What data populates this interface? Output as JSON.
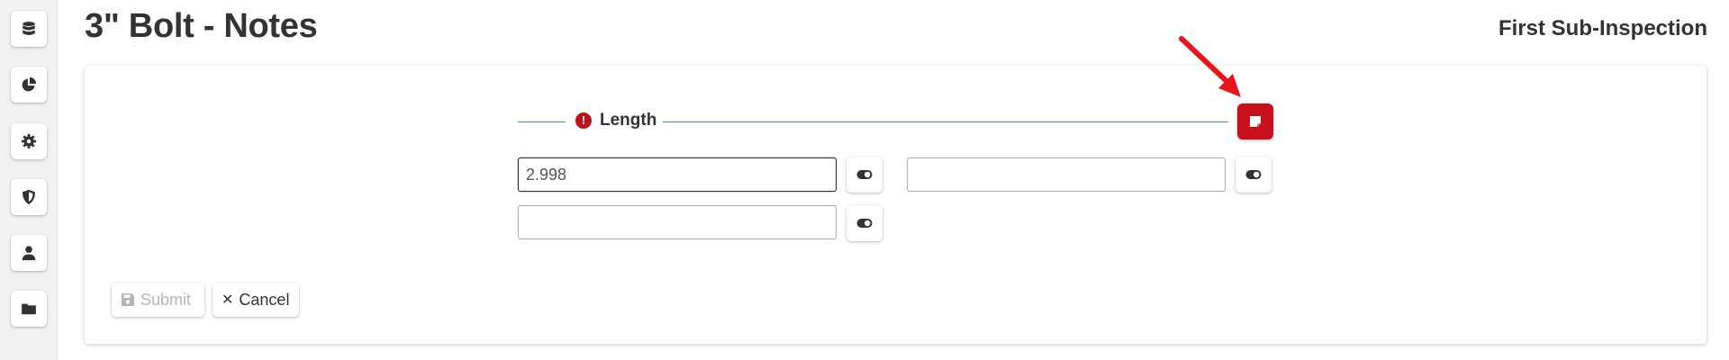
{
  "header": {
    "title": "3\" Bolt - Notes",
    "subtitle": "First Sub-Inspection"
  },
  "sidebar": {
    "items": [
      {
        "icon": "database-icon"
      },
      {
        "icon": "pie-chart-icon"
      },
      {
        "icon": "gear-icon"
      },
      {
        "icon": "shield-icon"
      },
      {
        "icon": "user-icon"
      },
      {
        "icon": "folder-icon"
      }
    ]
  },
  "section": {
    "label": "Length",
    "status_icon": "error-icon",
    "status_color": "#c0101a",
    "note_button_icon": "sticky-note-icon",
    "note_button_color": "#c8101c"
  },
  "fields": [
    {
      "value": "2.998"
    },
    {
      "value": ""
    },
    {
      "value": ""
    }
  ],
  "actions": {
    "submit_label": "Submit",
    "cancel_label": "Cancel"
  },
  "annotation": {
    "arrow_color": "#e8141c"
  }
}
